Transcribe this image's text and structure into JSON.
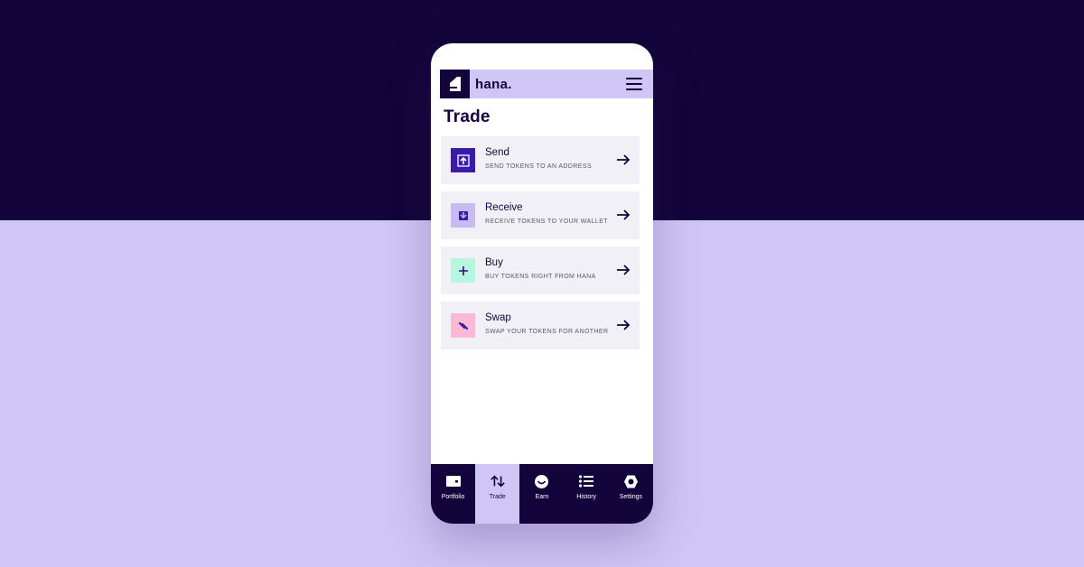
{
  "app": {
    "brand": "hana.",
    "page_title": "Trade"
  },
  "actions": [
    {
      "title": "Send",
      "subtitle": "SEND TOKENS TO AN ADDRESS",
      "icon": "upload-icon",
      "icon_bg": "#3a1aa8"
    },
    {
      "title": "Receive",
      "subtitle": "RECEIVE TOKENS TO YOUR WALLET",
      "icon": "download-icon",
      "icon_bg": "#c7bcf2"
    },
    {
      "title": "Buy",
      "subtitle": "BUY TOKENS RIGHT FROM HANA",
      "icon": "plus-icon",
      "icon_bg": "#b7f5de"
    },
    {
      "title": "Swap",
      "subtitle": "SWAP YOUR TOKENS FOR ANOTHER",
      "icon": "swap-icon",
      "icon_bg": "#fbb9d3"
    }
  ],
  "tabs": [
    {
      "label": "Portfolio",
      "icon": "wallet-icon",
      "active": false
    },
    {
      "label": "Trade",
      "icon": "trade-arrows-icon",
      "active": true
    },
    {
      "label": "Earn",
      "icon": "smile-icon",
      "active": false
    },
    {
      "label": "History",
      "icon": "list-icon",
      "active": false
    },
    {
      "label": "Settings",
      "icon": "hexagon-gear-icon",
      "active": false
    }
  ],
  "colors": {
    "navy": "#13053b",
    "lavender": "#d0c6f5",
    "card": "#f1f0f6"
  }
}
